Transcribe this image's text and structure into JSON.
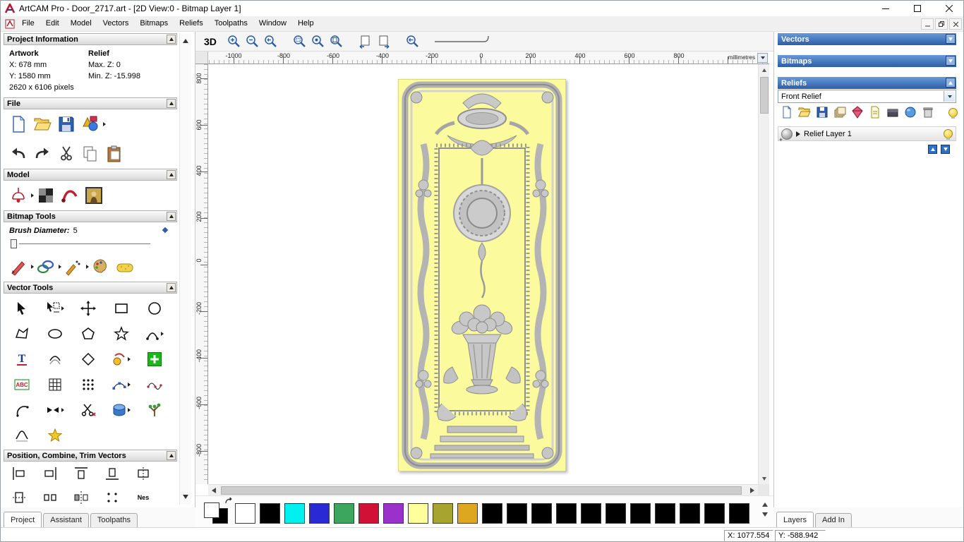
{
  "titlebar": {
    "title": "ArtCAM Pro - Door_2717.art - [2D View:0 - Bitmap Layer 1]"
  },
  "menubar": {
    "items": [
      "File",
      "Edit",
      "Model",
      "Vectors",
      "Bitmaps",
      "Reliefs",
      "Toolpaths",
      "Window",
      "Help"
    ]
  },
  "left_panel": {
    "project_info": {
      "title": "Project Information",
      "artwork_header": "Artwork",
      "relief_header": "Relief",
      "artwork_x": "X: 678 mm",
      "artwork_y": "Y: 1580 mm",
      "artwork_pixels": "2620 x 6106 pixels",
      "relief_max_z": "Max. Z: 0",
      "relief_min_z": "Min. Z: -15.998"
    },
    "file_title": "File",
    "model_title": "Model",
    "bitmap_tools_title": "Bitmap Tools",
    "brush_label": "Brush Diameter:",
    "brush_value": "5",
    "vector_tools_title": "Vector Tools",
    "position_title": "Position, Combine, Trim Vectors",
    "nest_icon_label": "Nes",
    "tabs": {
      "project": "Project",
      "assistant": "Assistant",
      "toolpaths": "Toolpaths"
    }
  },
  "toolbar": {
    "mode_3d_label": "3D"
  },
  "rulers": {
    "unit": "millimetres",
    "horizontal": [
      "-1000",
      "-800",
      "-600",
      "-400",
      "-200",
      "0",
      "200",
      "400",
      "600",
      "800"
    ],
    "vertical": [
      "800",
      "600",
      "400",
      "200",
      "0",
      "-200",
      "-400",
      "-600",
      "-800"
    ]
  },
  "palette": {
    "foreground": "#ffffff",
    "background": "#000000",
    "colors": [
      "#ffffff",
      "#000000",
      "#00f0f0",
      "#2a2ad4",
      "#3da65e",
      "#d11236",
      "#9a31cb",
      "#ffff9c",
      "#a7a52f",
      "#dda81f",
      "#000000",
      "#000000",
      "#000000",
      "#000000",
      "#000000",
      "#000000",
      "#000000",
      "#000000",
      "#000000",
      "#000000",
      "#000000"
    ]
  },
  "right_panel": {
    "vectors_title": "Vectors",
    "bitmaps_title": "Bitmaps",
    "reliefs_title": "Reliefs",
    "relief_combo_value": "Front Relief",
    "layer_name": "Relief Layer 1",
    "tabs": {
      "layers": "Layers",
      "add_in": "Add In"
    }
  },
  "statusbar": {
    "x": "X: 1077.554",
    "y": "Y: -588.942"
  }
}
